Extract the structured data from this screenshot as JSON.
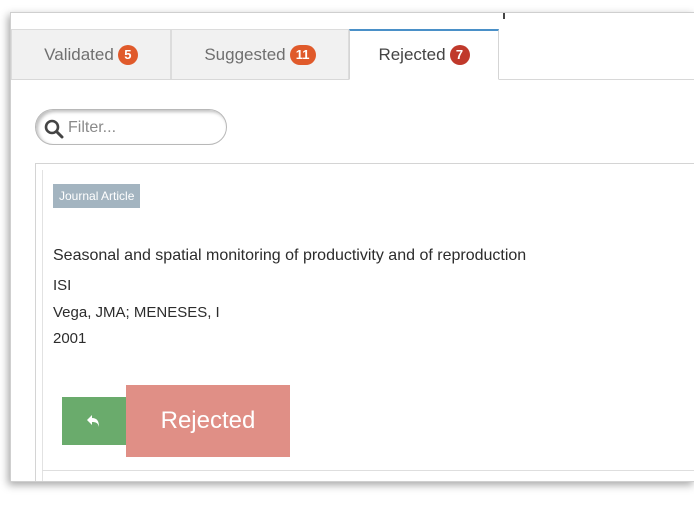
{
  "tabs": [
    {
      "label": "Validated",
      "count": "5"
    },
    {
      "label": "Suggested",
      "count": "11"
    },
    {
      "label": "Rejected",
      "count": "7"
    }
  ],
  "filter": {
    "placeholder": "Filter..."
  },
  "item": {
    "type": "Journal Article",
    "title": "Seasonal and spatial monitoring of productivity and of reproduction",
    "source": "ISI",
    "authors": "Vega, JMA; MENESES, I",
    "year": "2001",
    "status_label": "Rejected"
  },
  "icons": {
    "search": "search-icon",
    "undo": "undo-icon"
  },
  "colors": {
    "active_tab_border": "#4a90c8",
    "badge": "#e05a2b",
    "badge_rejected": "#c0392b",
    "type_label": "#a3b4c0",
    "undo_button": "#6aab6c",
    "rejected_button": "#e08f86"
  }
}
